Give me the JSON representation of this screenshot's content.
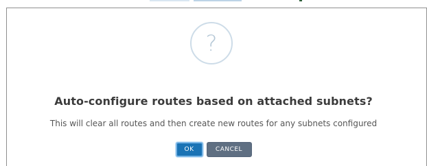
{
  "dialog": {
    "icon": "question-mark-icon",
    "icon_glyph": "?",
    "title": "Auto-configure routes based on attached subnets?",
    "message": "This will clear all routes and then create new routes for any subnets configured",
    "ok_label": "OK",
    "cancel_label": "CANCEL"
  },
  "colors": {
    "ok_button": "#1a73b5",
    "cancel_button": "#5f6f82",
    "title_text": "#3b3b3b",
    "icon_ring": "#cddce8"
  }
}
